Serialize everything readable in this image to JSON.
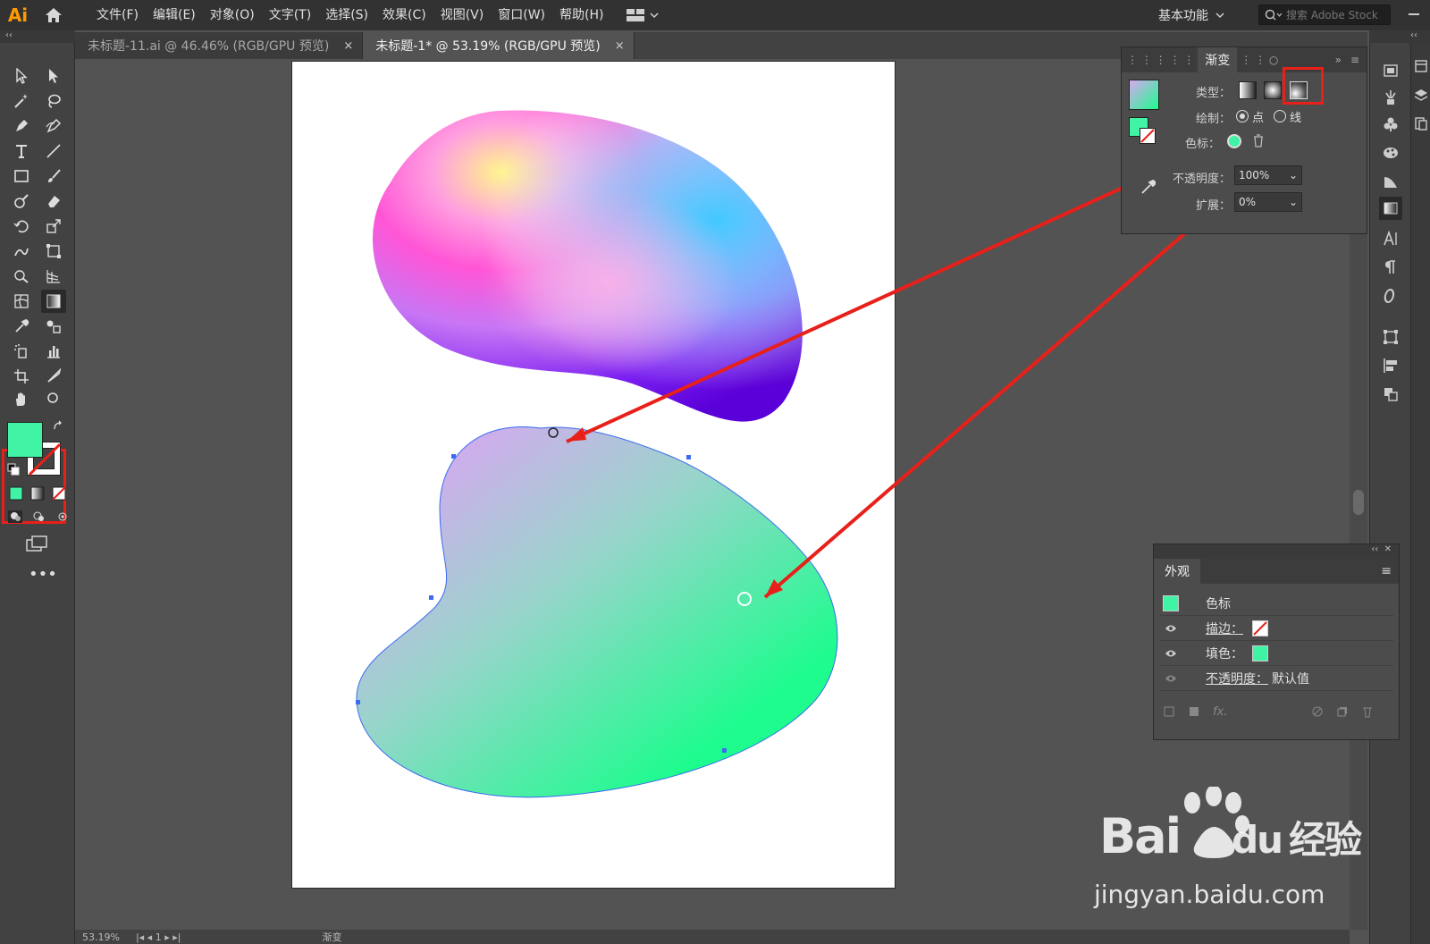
{
  "app": {
    "logo": "Ai"
  },
  "menus": [
    "文件(F)",
    "编辑(E)",
    "对象(O)",
    "文字(T)",
    "选择(S)",
    "效果(C)",
    "视图(V)",
    "窗口(W)",
    "帮助(H)"
  ],
  "workspace": {
    "label": "基本功能"
  },
  "stock_search": {
    "placeholder": "搜索 Adobe Stock"
  },
  "tabs": [
    {
      "label": "未标题-11.ai @ 46.46% (RGB/GPU 预览)",
      "close": "×"
    },
    {
      "label": "未标题-1* @ 53.19% (RGB/GPU 预览)",
      "close": "×"
    }
  ],
  "gradient_panel": {
    "tab": "渐变",
    "type_label": "类型：",
    "draw_label": "绘制：",
    "draw_point": "点",
    "draw_line": "线",
    "stop_label": "色标：",
    "opacity_label": "不透明度：",
    "opacity_value": "100%",
    "extend_label": "扩展：",
    "extend_value": "0%"
  },
  "appearance_panel": {
    "tab": "外观",
    "rows": {
      "title": "色标",
      "stroke": "描边：",
      "fill": "填色：",
      "opacity": "不透明度：",
      "opacity_value": "默认值"
    }
  },
  "status": {
    "zoom": "53.19%",
    "page": "1",
    "tool": "渐变"
  },
  "watermark": {
    "brand": "Bai",
    "du": "du",
    "sub": "经验",
    "url": "jingyan.baidu.com"
  },
  "colors": {
    "fill": "#41f3a5",
    "highlight": "#e8201a",
    "accent_orange": "#ff9a00"
  }
}
